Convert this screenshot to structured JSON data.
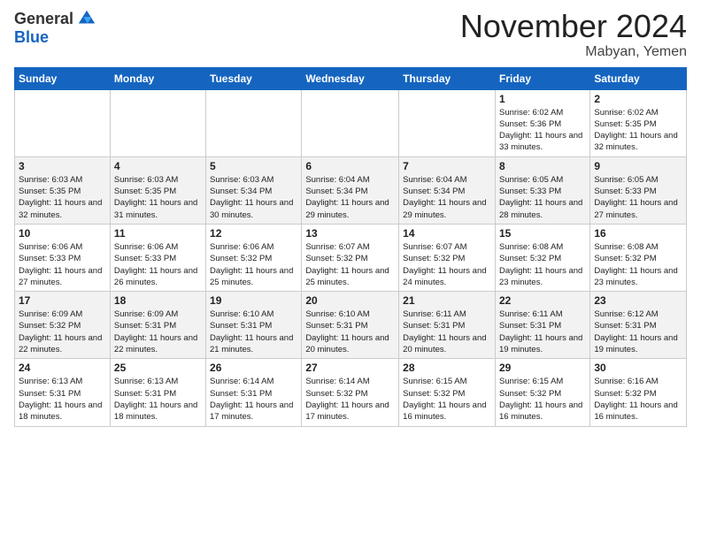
{
  "logo": {
    "general": "General",
    "blue": "Blue"
  },
  "title": "November 2024",
  "location": "Mabyan, Yemen",
  "days_of_week": [
    "Sunday",
    "Monday",
    "Tuesday",
    "Wednesday",
    "Thursday",
    "Friday",
    "Saturday"
  ],
  "weeks": [
    [
      {
        "day": "",
        "empty": true
      },
      {
        "day": "",
        "empty": true
      },
      {
        "day": "",
        "empty": true
      },
      {
        "day": "",
        "empty": true
      },
      {
        "day": "",
        "empty": true
      },
      {
        "day": "1",
        "sunrise": "6:02 AM",
        "sunset": "5:36 PM",
        "daylight": "11 hours and 33 minutes."
      },
      {
        "day": "2",
        "sunrise": "6:02 AM",
        "sunset": "5:35 PM",
        "daylight": "11 hours and 32 minutes."
      }
    ],
    [
      {
        "day": "3",
        "sunrise": "6:03 AM",
        "sunset": "5:35 PM",
        "daylight": "11 hours and 32 minutes."
      },
      {
        "day": "4",
        "sunrise": "6:03 AM",
        "sunset": "5:35 PM",
        "daylight": "11 hours and 31 minutes."
      },
      {
        "day": "5",
        "sunrise": "6:03 AM",
        "sunset": "5:34 PM",
        "daylight": "11 hours and 30 minutes."
      },
      {
        "day": "6",
        "sunrise": "6:04 AM",
        "sunset": "5:34 PM",
        "daylight": "11 hours and 29 minutes."
      },
      {
        "day": "7",
        "sunrise": "6:04 AM",
        "sunset": "5:34 PM",
        "daylight": "11 hours and 29 minutes."
      },
      {
        "day": "8",
        "sunrise": "6:05 AM",
        "sunset": "5:33 PM",
        "daylight": "11 hours and 28 minutes."
      },
      {
        "day": "9",
        "sunrise": "6:05 AM",
        "sunset": "5:33 PM",
        "daylight": "11 hours and 27 minutes."
      }
    ],
    [
      {
        "day": "10",
        "sunrise": "6:06 AM",
        "sunset": "5:33 PM",
        "daylight": "11 hours and 27 minutes."
      },
      {
        "day": "11",
        "sunrise": "6:06 AM",
        "sunset": "5:33 PM",
        "daylight": "11 hours and 26 minutes."
      },
      {
        "day": "12",
        "sunrise": "6:06 AM",
        "sunset": "5:32 PM",
        "daylight": "11 hours and 25 minutes."
      },
      {
        "day": "13",
        "sunrise": "6:07 AM",
        "sunset": "5:32 PM",
        "daylight": "11 hours and 25 minutes."
      },
      {
        "day": "14",
        "sunrise": "6:07 AM",
        "sunset": "5:32 PM",
        "daylight": "11 hours and 24 minutes."
      },
      {
        "day": "15",
        "sunrise": "6:08 AM",
        "sunset": "5:32 PM",
        "daylight": "11 hours and 23 minutes."
      },
      {
        "day": "16",
        "sunrise": "6:08 AM",
        "sunset": "5:32 PM",
        "daylight": "11 hours and 23 minutes."
      }
    ],
    [
      {
        "day": "17",
        "sunrise": "6:09 AM",
        "sunset": "5:32 PM",
        "daylight": "11 hours and 22 minutes."
      },
      {
        "day": "18",
        "sunrise": "6:09 AM",
        "sunset": "5:31 PM",
        "daylight": "11 hours and 22 minutes."
      },
      {
        "day": "19",
        "sunrise": "6:10 AM",
        "sunset": "5:31 PM",
        "daylight": "11 hours and 21 minutes."
      },
      {
        "day": "20",
        "sunrise": "6:10 AM",
        "sunset": "5:31 PM",
        "daylight": "11 hours and 20 minutes."
      },
      {
        "day": "21",
        "sunrise": "6:11 AM",
        "sunset": "5:31 PM",
        "daylight": "11 hours and 20 minutes."
      },
      {
        "day": "22",
        "sunrise": "6:11 AM",
        "sunset": "5:31 PM",
        "daylight": "11 hours and 19 minutes."
      },
      {
        "day": "23",
        "sunrise": "6:12 AM",
        "sunset": "5:31 PM",
        "daylight": "11 hours and 19 minutes."
      }
    ],
    [
      {
        "day": "24",
        "sunrise": "6:13 AM",
        "sunset": "5:31 PM",
        "daylight": "11 hours and 18 minutes."
      },
      {
        "day": "25",
        "sunrise": "6:13 AM",
        "sunset": "5:31 PM",
        "daylight": "11 hours and 18 minutes."
      },
      {
        "day": "26",
        "sunrise": "6:14 AM",
        "sunset": "5:31 PM",
        "daylight": "11 hours and 17 minutes."
      },
      {
        "day": "27",
        "sunrise": "6:14 AM",
        "sunset": "5:32 PM",
        "daylight": "11 hours and 17 minutes."
      },
      {
        "day": "28",
        "sunrise": "6:15 AM",
        "sunset": "5:32 PM",
        "daylight": "11 hours and 16 minutes."
      },
      {
        "day": "29",
        "sunrise": "6:15 AM",
        "sunset": "5:32 PM",
        "daylight": "11 hours and 16 minutes."
      },
      {
        "day": "30",
        "sunrise": "6:16 AM",
        "sunset": "5:32 PM",
        "daylight": "11 hours and 16 minutes."
      }
    ]
  ]
}
